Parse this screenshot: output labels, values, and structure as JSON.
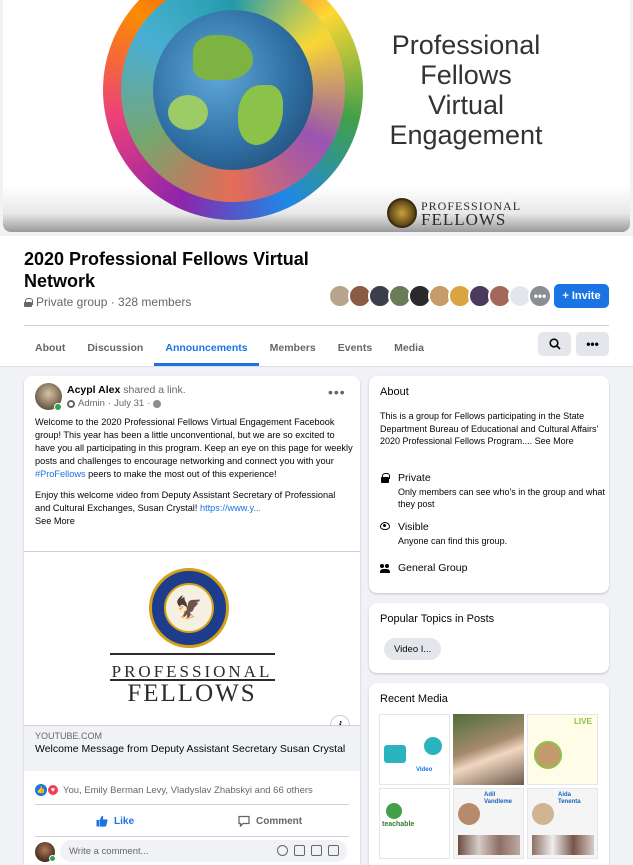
{
  "cover": {
    "title_line1": "Professional",
    "title_line2": "Fellows",
    "title_line3": "Virtual",
    "title_line4": "Engagement",
    "logo_line1": "PROFESSIONAL",
    "logo_line2": "FELLOWS"
  },
  "group": {
    "title": "2020 Professional Fellows Virtual Network",
    "meta": "Private group · 328 members",
    "invite_label": "Invite",
    "lock_icon": "lock-icon"
  },
  "tabs": [
    {
      "label": "About"
    },
    {
      "label": "Discussion"
    },
    {
      "label": "Announcements"
    },
    {
      "label": "Members"
    },
    {
      "label": "Events"
    },
    {
      "label": "Media"
    }
  ],
  "active_tab": "Announcements",
  "post": {
    "author": "Acypl Alex",
    "action": " shared a link.",
    "role": "Admin",
    "date": "July 31",
    "para1_a": "Welcome to the 2020 Professional Fellows Virtual Engagement Facebook group! This year has been a little unconventional, but we are so excited to have you all participating in this program. Keep an eye on this page for weekly posts and challenges to encourage networking and connect you with your ",
    "hashtag": "#ProFellows",
    "para1_b": " peers to make the most out of this experience!",
    "para2": "Enjoy this welcome video from Deputy Assistant Secretary of Professional and Cultural Exchanges, Susan Crystal! ",
    "link_text": "https://www.y...",
    "see_more": "See More",
    "image_text1": "PROFESSIONAL",
    "image_text2": "FELLOWS",
    "link_domain": "YOUTUBE.COM",
    "link_title": "Welcome Message from Deputy Assistant Secretary Susan Crystal",
    "reactions_text": "You, Emily Berman Levy, Vladyslav Zhabskyi and 66 others",
    "like_label": "Like",
    "comment_label": "Comment",
    "comment_placeholder": "Write a comment..."
  },
  "about": {
    "title": "About",
    "description": "This is a group for Fellows participating in the State Department Bureau of Educational and Cultural Affairs' 2020 Professional Fellows Program.... ",
    "see_more": "See More",
    "private_title": "Private",
    "private_desc": "Only members can see who's in the group and what they post",
    "visible_title": "Visible",
    "visible_desc": "Anyone can find this group.",
    "general_title": "General Group"
  },
  "topics": {
    "title": "Popular Topics in Posts",
    "pill": "Video I..."
  },
  "media": {
    "title": "Recent Media",
    "thumb1_label": "Video",
    "thumb3_label": "LIVE",
    "thumb4_label": "teachable",
    "thumb5_label": "Adil Vandleme",
    "thumb6_label": "Aida Tenenta"
  },
  "colors": {
    "accent": "#1b74e4",
    "background": "#f0f2f5",
    "online": "#31a24c"
  }
}
